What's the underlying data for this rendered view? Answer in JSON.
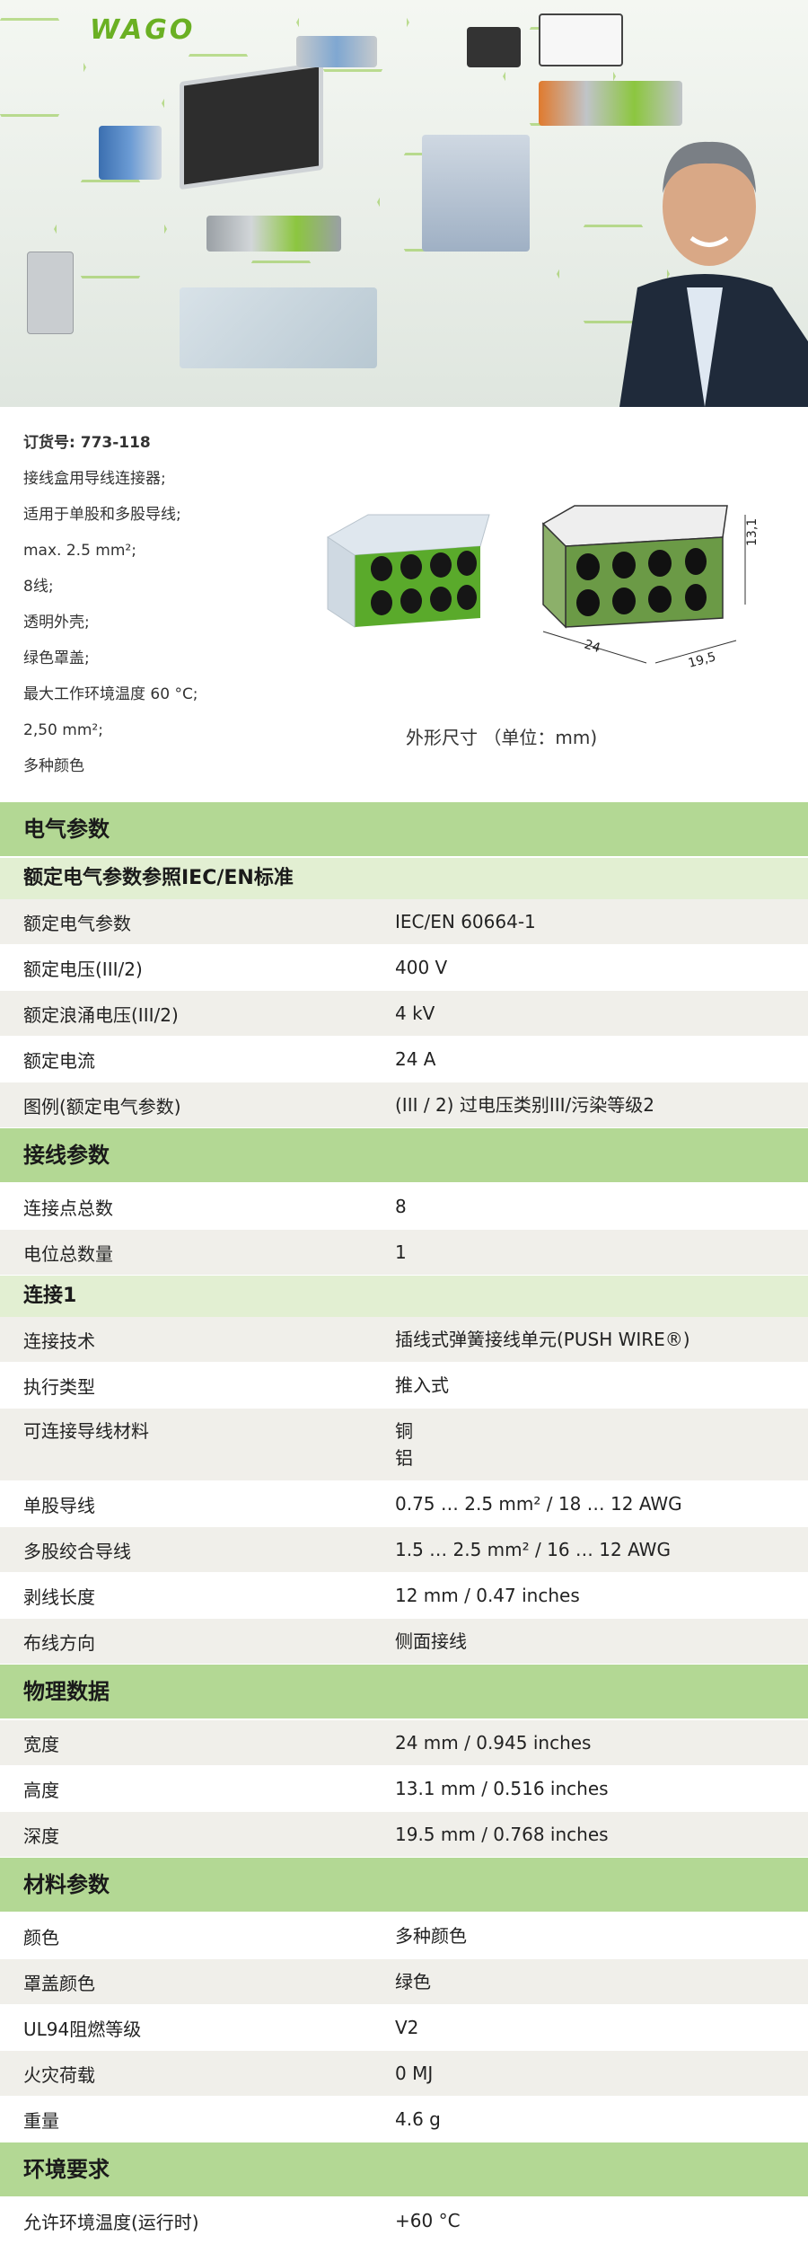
{
  "hero": {
    "brand": "WAGO"
  },
  "info": {
    "order_label": "订货号:",
    "order_number": "773-118",
    "lines": [
      "接线盒用导线连接器;",
      "适用于单股和多股导线;",
      "max. 2.5 mm²;",
      "8线;",
      "透明外壳;",
      "绿色罩盖;",
      "最大工作环境温度 60 °C;",
      "2,50 mm²;",
      "多种颜色"
    ],
    "dimension_caption": "外形尺寸 （单位：mm)",
    "dim_24": "24",
    "dim_195": "19,5",
    "dim_131": "13,1"
  },
  "colors": {
    "accent_green": "#6ab023",
    "section_bg": "#b3d894",
    "sub_bg": "#e2efd2",
    "row_alt": "#f0efea"
  },
  "sections": {
    "electrical": {
      "title": "电气参数",
      "sub_title": "额定电气参数参照IEC/EN标准",
      "rows": [
        {
          "k": "额定电气参数",
          "v": "IEC/EN 60664-1"
        },
        {
          "k": "额定电压(III/2)",
          "v": "400 V"
        },
        {
          "k": "额定浪涌电压(III/2)",
          "v": "4 kV"
        },
        {
          "k": "额定电流",
          "v": "24 A"
        },
        {
          "k": "图例(额定电气参数)",
          "v": "(III / 2)  过电压类别III/污染等级2"
        }
      ]
    },
    "wiring": {
      "title": "接线参数",
      "rows": [
        {
          "k": "连接点总数",
          "v": "8"
        },
        {
          "k": "电位总数量",
          "v": "1"
        }
      ],
      "sub_title": "连接1",
      "rows2": [
        {
          "k": "连接技术",
          "v": "插线式弹簧接线单元(PUSH WIRE®)"
        },
        {
          "k": "执行类型",
          "v": "推入式"
        },
        {
          "k": "可连接导线材料",
          "v": "铜",
          "v2": "铝"
        },
        {
          "k": "单股导线",
          "v": "0.75 … 2.5 mm² / 18 … 12 AWG"
        },
        {
          "k": "多股绞合导线",
          "v": "1.5 … 2.5 mm² / 16 … 12 AWG"
        },
        {
          "k": "剥线长度",
          "v": "12 mm / 0.47 inches"
        },
        {
          "k": "布线方向",
          "v": "侧面接线"
        }
      ]
    },
    "physical": {
      "title": "物理数据",
      "rows": [
        {
          "k": "宽度",
          "v": "24 mm / 0.945 inches"
        },
        {
          "k": "高度",
          "v": "13.1 mm / 0.516 inches"
        },
        {
          "k": "深度",
          "v": "19.5 mm / 0.768 inches"
        }
      ]
    },
    "material": {
      "title": "材料参数",
      "rows": [
        {
          "k": "颜色",
          "v": "多种颜色"
        },
        {
          "k": "罩盖颜色",
          "v": "绿色"
        },
        {
          "k": "UL94阻燃等级",
          "v": "V2"
        },
        {
          "k": "火灾荷载",
          "v": "0 MJ"
        },
        {
          "k": "重量",
          "v": "4.6 g"
        }
      ]
    },
    "environment": {
      "title": "环境要求",
      "rows": [
        {
          "k": "允许环境温度(运行时)",
          "v": "+60 °C"
        }
      ]
    }
  }
}
